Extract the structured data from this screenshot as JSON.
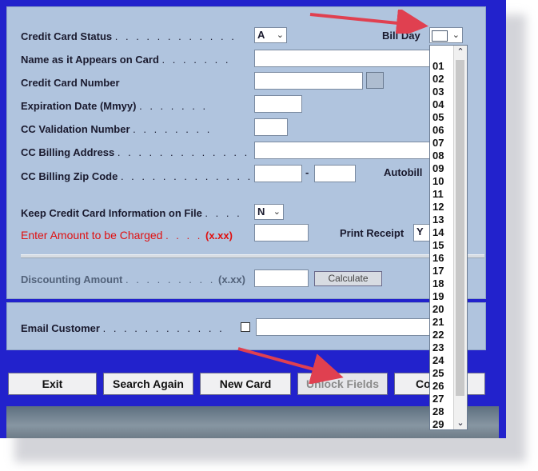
{
  "form": {
    "credit_card_status_label": "Credit Card Status",
    "credit_card_status_value": "A",
    "bill_day_label": "Bill Day",
    "bill_day_value": "",
    "name_on_card_label": "Name as it Appears on Card",
    "name_on_card_value": "",
    "cc_number_label": "Credit Card Number",
    "cc_number_value": "",
    "expiration_label": "Expiration Date  (Mmyy)",
    "expiration_value": "",
    "cc_validation_label": "CC Validation Number",
    "cc_validation_value": "",
    "billing_address_label": "CC Billing Address",
    "billing_address_value": "",
    "billing_zip_label": "CC Billing Zip Code",
    "zip_separator": "-",
    "zip_value": "",
    "zip_ext_value": "",
    "autobill_label": "Autobill",
    "keep_on_file_label": "Keep Credit Card Information on File",
    "keep_on_file_value": "N",
    "amount_label": "Enter Amount to be Charged",
    "amount_format": "(x.xx)",
    "amount_value": "",
    "print_receipt_label": "Print Receipt",
    "print_receipt_value": "Y",
    "discounting_label": "Discounting Amount",
    "discounting_format": "(x.xx)",
    "discounting_value": "",
    "calculate_label": "Calculate",
    "email_label": "Email Customer",
    "email_value": ""
  },
  "bill_day_options": [
    "01",
    "02",
    "03",
    "04",
    "05",
    "06",
    "07",
    "08",
    "09",
    "10",
    "11",
    "12",
    "13",
    "14",
    "15",
    "16",
    "17",
    "18",
    "19",
    "20",
    "21",
    "22",
    "23",
    "24",
    "25",
    "26",
    "27",
    "28",
    "29"
  ],
  "buttons": {
    "exit": "Exit",
    "search_again": "Search Again",
    "new_card": "New Card",
    "unlock_fields": "Unlock Fields",
    "continue_partial": "Co"
  },
  "colors": {
    "window": "#2222cc",
    "panel": "#b0c4de",
    "red_label": "#e01010",
    "annotation_arrow": "#e04050"
  },
  "icons": {
    "dropdown_chevron": "chevron-down",
    "scroll_up": "chevron-up",
    "scroll_down": "chevron-down",
    "annotation": "red-arrow"
  }
}
